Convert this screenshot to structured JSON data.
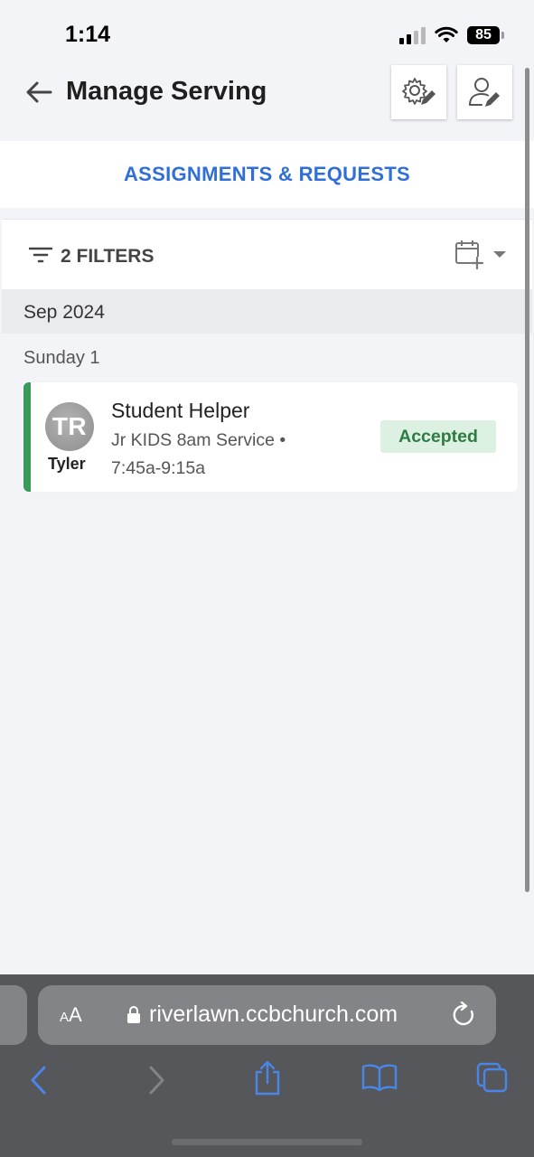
{
  "status_bar": {
    "time": "1:14",
    "battery": "85"
  },
  "header": {
    "title": "Manage Serving"
  },
  "tabs": {
    "active_label": "ASSIGNMENTS & REQUESTS"
  },
  "filters": {
    "label": "2 FILTERS"
  },
  "schedule": {
    "month": "Sep 2024",
    "day": "Sunday 1",
    "assignments": [
      {
        "avatar_initials": "TR",
        "person": "Tyler",
        "role": "Student Helper",
        "service": "Jr KIDS 8am Service •",
        "time": "7:45a-9:15a",
        "status": "Accepted"
      }
    ]
  },
  "browser": {
    "aa_small": "A",
    "aa_large": "A",
    "url": "riverlawn.ccbchurch.com"
  },
  "colors": {
    "accent": "#2f6fd6",
    "status_accepted_bg": "#dcf1e2",
    "status_accepted_text": "#2e7b45",
    "card_stripe": "#3a9a5a"
  }
}
